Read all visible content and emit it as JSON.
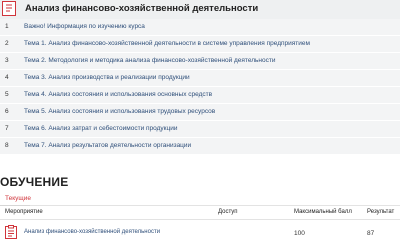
{
  "course": {
    "title": "Анализ финансово-хозяйственной деятельности",
    "icon": "document-icon"
  },
  "topics": [
    {
      "num": "1",
      "label": "Важно! Информация по изучению курса"
    },
    {
      "num": "2",
      "label": "Тема 1. Анализ финансово-хозяйственной деятельности в системе управления предприятием"
    },
    {
      "num": "3",
      "label": "Тема 2. Методология и методика анализа финансово-хозяйственной деятельности"
    },
    {
      "num": "4",
      "label": "Тема 3. Анализ производства и реализации продукции"
    },
    {
      "num": "5",
      "label": "Тема 4. Анализ состояния и использования основных средств"
    },
    {
      "num": "6",
      "label": "Тема 5. Анализ состояния и использования трудовых ресурсов"
    },
    {
      "num": "7",
      "label": "Тема 6. Анализ затрат и себестоимости продукции"
    },
    {
      "num": "8",
      "label": "Тема 7. Анализ результатов деятельности организации"
    }
  ],
  "training": {
    "section_title": "ОБУЧЕНИЕ",
    "tab_current": "Текущие",
    "columns": {
      "event": "Мероприятие",
      "access": "Доступ",
      "max_score": "Максимальный балл",
      "result": "Результат"
    },
    "rows": [
      {
        "name": "Анализ финансово-хозяйственной деятельности",
        "access": "",
        "max_score": "100",
        "result": "87"
      }
    ]
  },
  "colors": {
    "accent_red": "#d0343b",
    "link_blue": "#2f4f7a",
    "row_bg": "#f3f4f5"
  }
}
